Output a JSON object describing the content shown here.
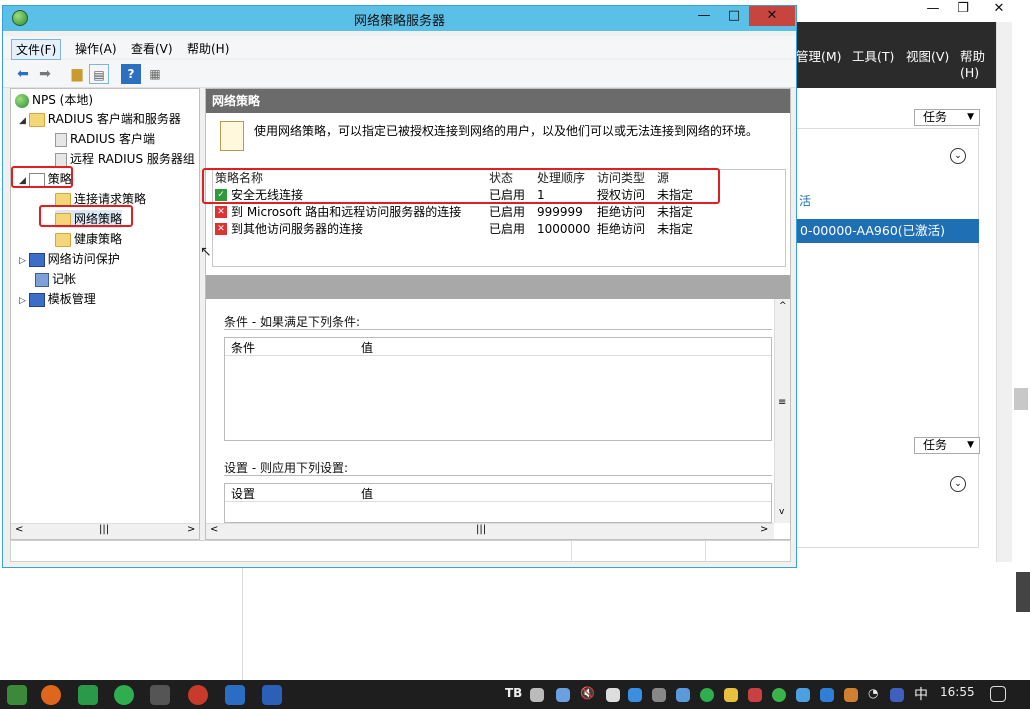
{
  "window": {
    "title": "网络策略服务器",
    "minimize": "—",
    "maximize": "□",
    "close": "✕"
  },
  "menu": [
    "文件(F)",
    "操作(A)",
    "查看(V)",
    "帮助(H)"
  ],
  "tree": {
    "root": "NPS (本地)",
    "radius_group": "RADIUS 客户端和服务器",
    "radius_clients": "RADIUS 客户端",
    "remote_radius": "远程 RADIUS 服务器组",
    "policies": "策略",
    "connection_policies": "连接请求策略",
    "network_policies": "网络策略",
    "health_policies": "健康策略",
    "nap": "网络访问保护",
    "accounting": "记帐",
    "templates": "模板管理"
  },
  "panel": {
    "header": "网络策略",
    "description": "使用网络策略，可以指定已被授权连接到网络的用户，以及他们可以或无法连接到网络的环境。",
    "columns": [
      "策略名称",
      "状态",
      "处理顺序",
      "访问类型",
      "源"
    ],
    "rows": [
      {
        "name": "安全无线连接",
        "status": "已启用",
        "order": "1",
        "access": "授权访问",
        "source": "未指定",
        "icon": "check-icon"
      },
      {
        "name": "到 Microsoft 路由和远程访问服务器的连接",
        "status": "已启用",
        "order": "999999",
        "access": "拒绝访问",
        "source": "未指定",
        "icon": "deny-icon"
      },
      {
        "name": "到其他访问服务器的连接",
        "status": "已启用",
        "order": "1000000",
        "access": "拒绝访问",
        "source": "未指定",
        "icon": "deny-icon"
      }
    ],
    "conditions_title": "条件 - 如果满足下列条件:",
    "conditions_cols": [
      "条件",
      "值"
    ],
    "settings_title": "设置 - 则应用下列设置:",
    "settings_cols": [
      "设置",
      "值"
    ]
  },
  "background": {
    "menu": [
      "管理(M)",
      "工具(T)",
      "视图(V)",
      "帮助(H)"
    ],
    "task_label": "任务",
    "link_fragment": "活",
    "highlight": "0-00000-AA960(已激活)"
  },
  "taskbar": {
    "clock": "16:55",
    "ime": "中"
  },
  "colors": {
    "accent": "#5bc0e8",
    "highlight": "#e02020",
    "selection": "#1f6fb5"
  }
}
